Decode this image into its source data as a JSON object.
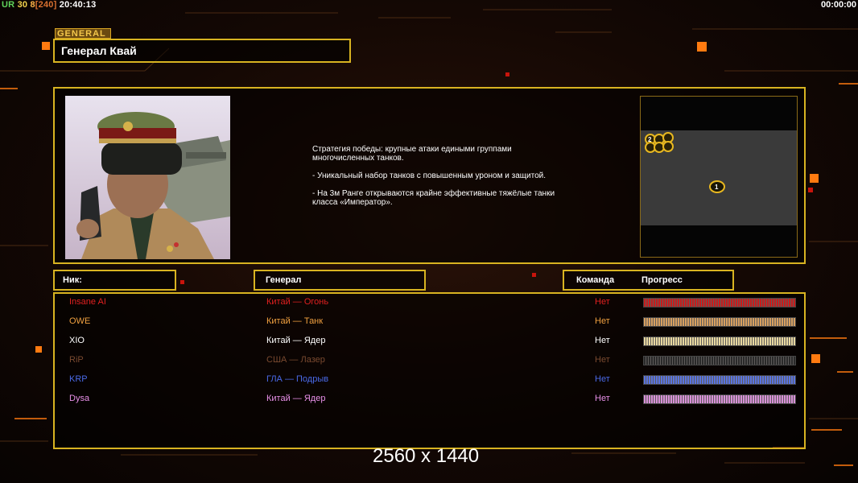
{
  "hud": {
    "ur_label": "UR",
    "fps": "30",
    "num": "8",
    "bracket": "[240]",
    "clock": "20:40:13",
    "timer": "00:00:00"
  },
  "general_tag": "GENERAL",
  "general_name": "Генерал Квай",
  "description": [
    "Стратегия победы: крупные атаки едиными группами\n многочисленных танков.",
    "- Уникальный набор танков с повышенным уроном и защитой.",
    "- На 3м Ранге открываются крайне эффективные тяжёлые танки\n класса «Император»."
  ],
  "map": {
    "marker_start": "2",
    "marker_player": "1"
  },
  "headers": {
    "nick": "Ник:",
    "general": "Генерал",
    "team": "Команда",
    "progress": "Прогресс"
  },
  "players": [
    {
      "nick": "Insane AI",
      "general": "Китай — Огонь",
      "team": "Нет",
      "color": "#e02020",
      "progress": 1.0
    },
    {
      "nick": "OWE",
      "general": "Китай — Танк",
      "team": "Нет",
      "color": "#f0a040",
      "progress": 1.0
    },
    {
      "nick": "XIO",
      "general": "Китай — Ядер",
      "team": "Нет",
      "color": "#ffffff",
      "progress": 1.0
    },
    {
      "nick": "RiP",
      "general": "США — Лазер",
      "team": "Нет",
      "color": "#7a4a30",
      "progress": 1.0
    },
    {
      "nick": "KRP",
      "general": "ГЛА — Подрыв",
      "team": "Нет",
      "color": "#4a6ae8",
      "progress": 1.0
    },
    {
      "nick": "Dysa",
      "general": "Китай — Ядер",
      "team": "Нет",
      "color": "#e890e8",
      "progress": 1.0
    }
  ],
  "bar_colors": [
    "#c81c1c",
    "#d8a060",
    "#e8d8a0",
    "#2a2a2a",
    "#5a74e0",
    "#d890d8"
  ],
  "watermark": "2560 x 1440"
}
